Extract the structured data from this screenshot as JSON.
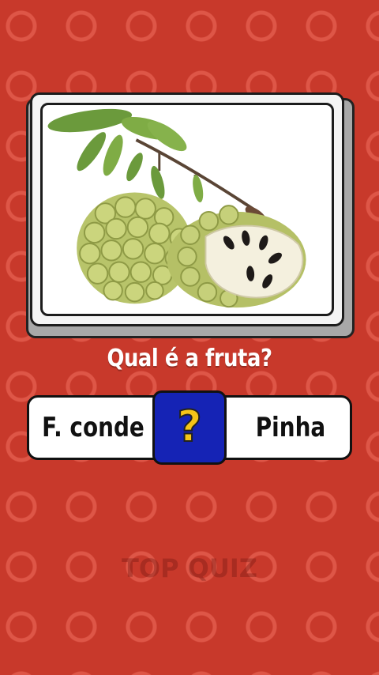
{
  "quiz": {
    "question": "Qual é a fruta?",
    "option_left": "F. conde",
    "option_right": "Pinha",
    "mystery_symbol": "?",
    "watermark": "TOP QUIZ"
  },
  "image": {
    "subject": "sugar-apple-fruit-photo"
  },
  "colors": {
    "background": "#c8392b",
    "pattern_ring": "#f06e5f",
    "card_frame": "#1c1c1c",
    "question_box": "#1523b5",
    "question_mark": "#f5c518",
    "question_text": "#ffffff"
  }
}
